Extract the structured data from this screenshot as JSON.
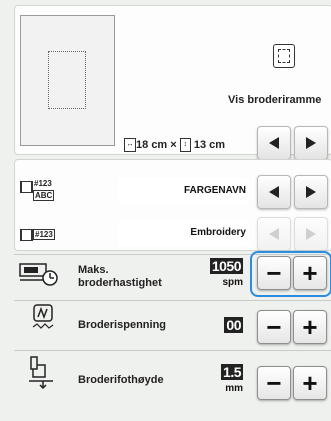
{
  "frame_panel": {
    "frame_label": "Vis broderiramme",
    "width_value": "18",
    "height_value": "13",
    "unit": "cm",
    "times": "×"
  },
  "thread_color_row": {
    "icon_text_top": "#123",
    "icon_text_bottom": "ABC",
    "value": "FARGENAVN"
  },
  "thread_brand_row": {
    "icon_text": "#123",
    "value": "Embroidery"
  },
  "speed_row": {
    "label_line1": "Maks.",
    "label_line2": "broderhastighet",
    "value": "1050",
    "unit": "spm"
  },
  "tension_row": {
    "label": "Broderispenning",
    "value": "00"
  },
  "foot_height_row": {
    "label": "Broderifothøyde",
    "value": "1.5",
    "unit": "mm"
  },
  "buttons": {
    "minus": "−",
    "plus": "+"
  },
  "colors": {
    "highlight": "#2a8de0",
    "background": "#eff1ee"
  }
}
